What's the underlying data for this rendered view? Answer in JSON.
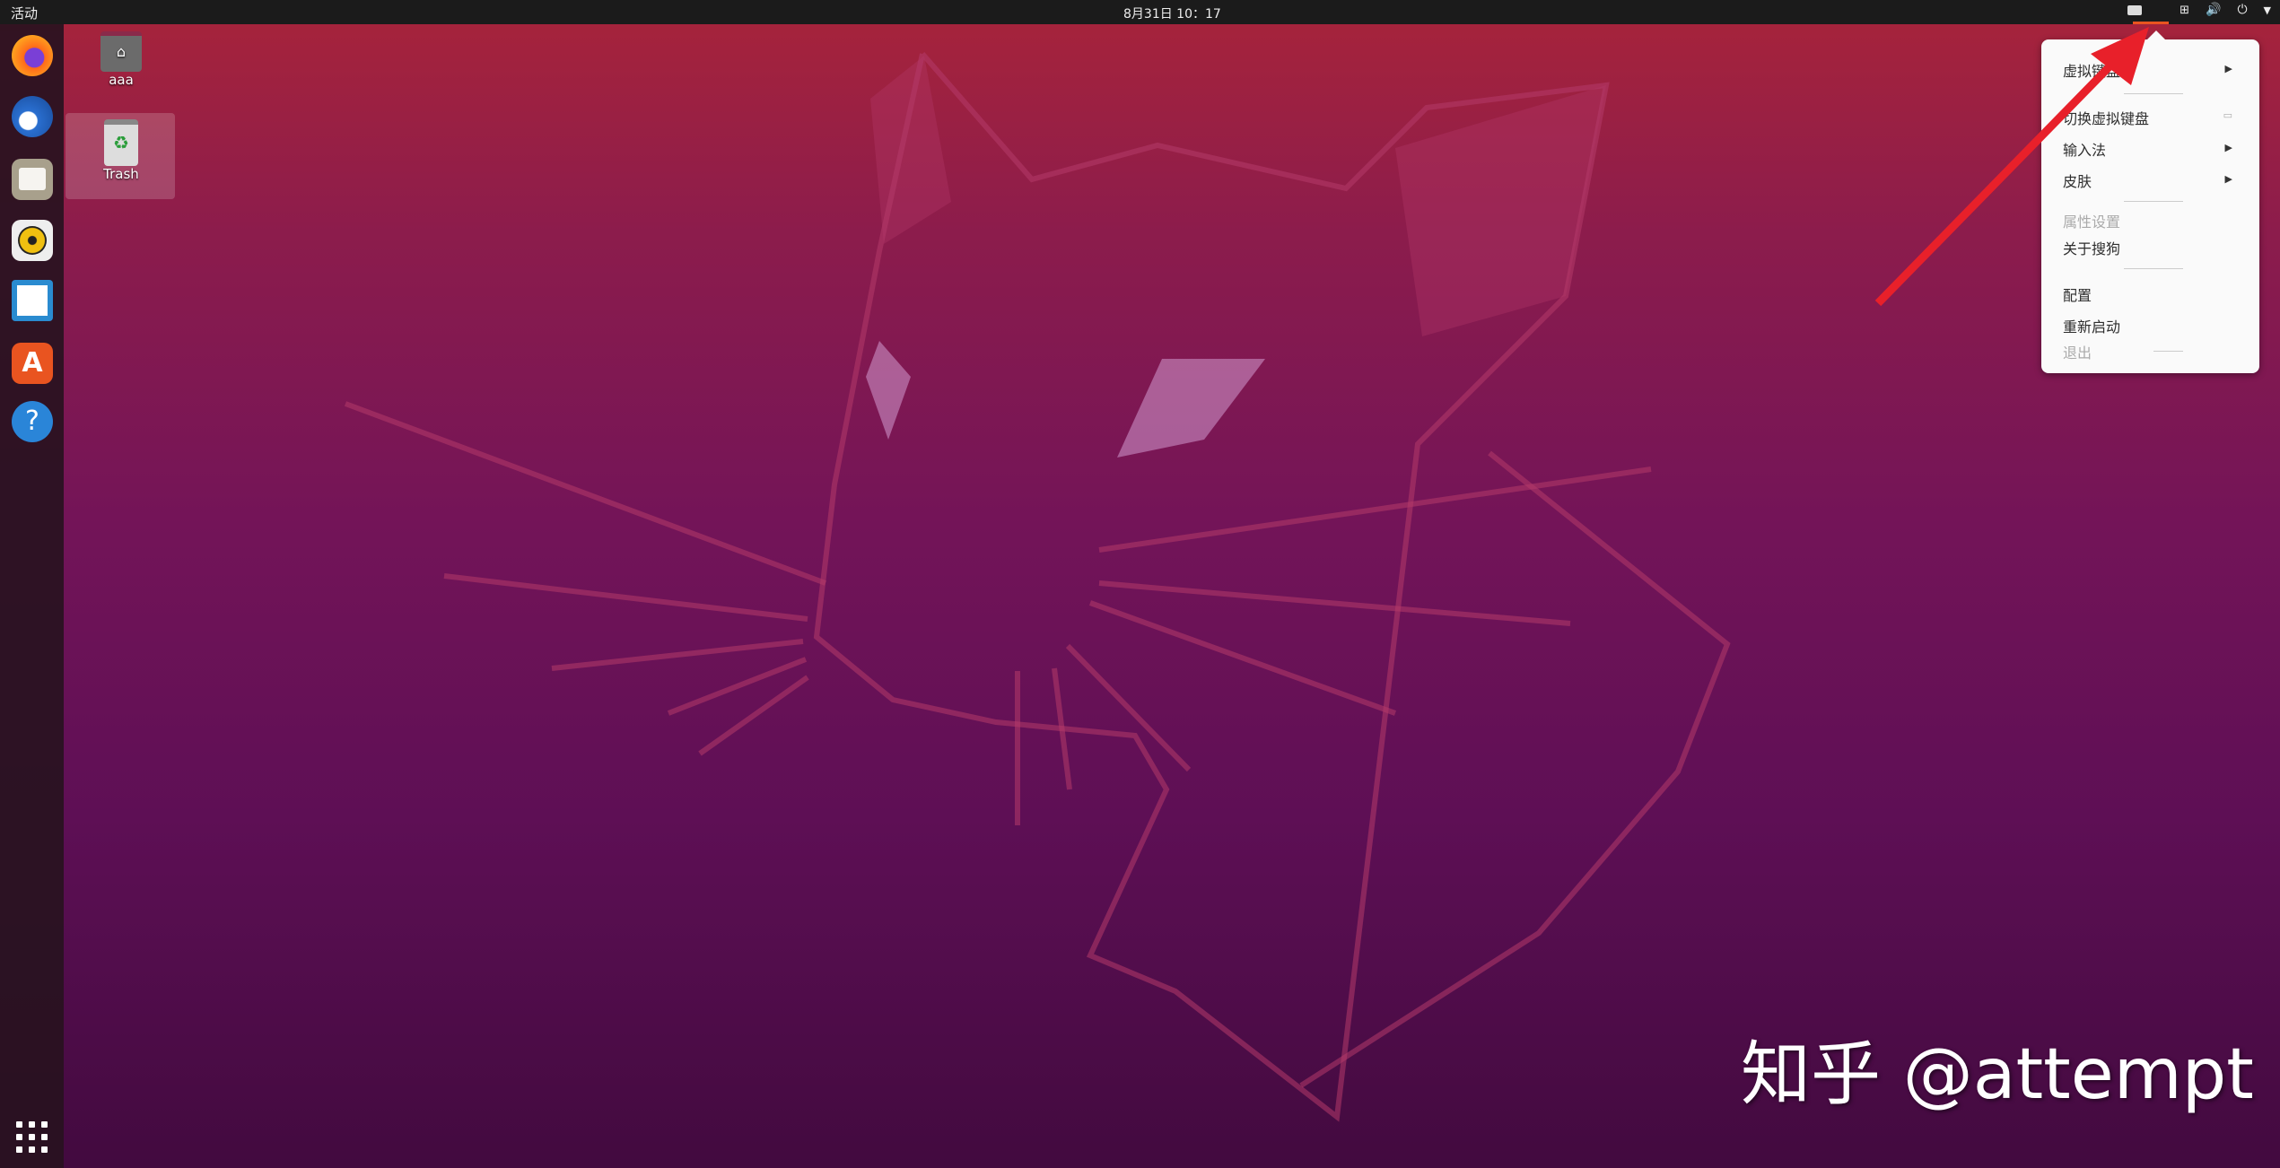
{
  "topbar": {
    "activities": "活动",
    "clock": "8月31日  10：17"
  },
  "desktop": {
    "icons": [
      {
        "label": "aaa",
        "icon": "home-folder-icon"
      },
      {
        "label": "Trash",
        "icon": "trash-icon"
      }
    ]
  },
  "dock": {
    "apps": [
      "firefox-icon",
      "thunderbird-icon",
      "files-icon",
      "rhythmbox-icon",
      "libreoffice-writer-icon",
      "ubuntu-software-icon",
      "help-icon"
    ],
    "show_apps": "show-applications-icon"
  },
  "input_menu": {
    "items": [
      {
        "label": "虚拟键盘",
        "submenu": true,
        "disabled": false
      },
      {
        "label": "切换虚拟键盘",
        "submenu": false,
        "disabled": false
      },
      {
        "label": "输入法",
        "submenu": true,
        "disabled": false
      },
      {
        "label": "皮肤",
        "submenu": true,
        "disabled": false
      },
      {
        "label": "属性设置",
        "submenu": false,
        "disabled": true
      },
      {
        "label": "关于搜狗",
        "submenu": false,
        "disabled": false
      },
      {
        "label": "配置",
        "submenu": false,
        "disabled": false
      },
      {
        "label": "重新启动",
        "submenu": false,
        "disabled": false
      },
      {
        "label": "退出",
        "submenu": false,
        "disabled": true
      }
    ]
  },
  "watermark": "知乎 @attempt",
  "colors": {
    "accent": "#e95420",
    "annotation_arrow": "#e8202a"
  }
}
